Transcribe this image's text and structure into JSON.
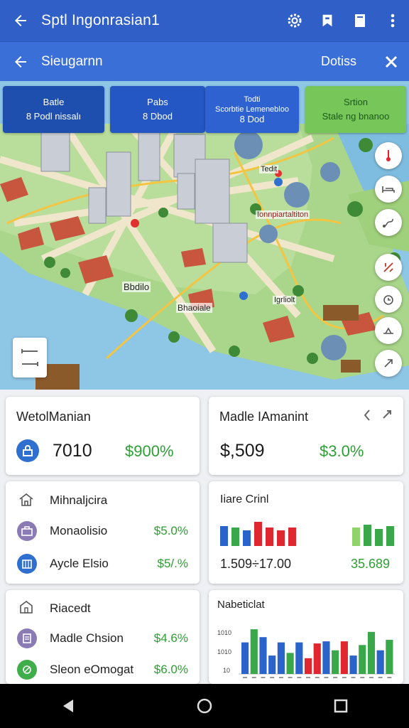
{
  "appbar": {
    "title": "Sptl Ingonrasian1",
    "back_icon": "arrow-left-icon",
    "actions": [
      "settings-gear-icon",
      "bookmark-icon",
      "document-icon",
      "more-vert-icon"
    ]
  },
  "subbar": {
    "title": "Sieugarnn",
    "option_label": "Dotiss",
    "close_icon": "close-icon"
  },
  "chips": [
    {
      "title": "Batle",
      "value": "8 Podl nissalı"
    },
    {
      "title": "Pabs",
      "value": "8 Dbod"
    },
    {
      "title": "Todti\nScorbtie Lemenebloo",
      "value": "8 Dod"
    },
    {
      "title": "Srtion",
      "value": "Stale ng bnanoo"
    }
  ],
  "map": {
    "labels": [
      "Bbdilo",
      "Ionnpiartaltiton",
      "Bhaoiale",
      "Tedit",
      "Igrliolt"
    ],
    "side_buttons": [
      "temperature-icon",
      "bed-icon",
      "route-icon",
      "dining-icon",
      "timer-icon",
      "fitness-icon",
      "pin-icon"
    ],
    "legend_icons": [
      "bus-icon",
      "tram-icon"
    ]
  },
  "cards": {
    "card1": {
      "title": "WetolManian",
      "icon": "lock-icon",
      "value": "7010",
      "percent": "$900%"
    },
    "card2": {
      "title": "Madle IAmanint",
      "value": "$,509",
      "percent": "$3.0%",
      "prev_icon": "chevron-left-icon",
      "next_icon": "chevron-right-icon"
    },
    "card3": {
      "title": "Mihnaljcira",
      "title_icon": "home-icon",
      "rows": [
        {
          "label": "Monaolisio",
          "value": "$5.0%",
          "icon": "briefcase-icon",
          "color": "#8a7bb5"
        },
        {
          "label": "Aycle Elsio",
          "value": "$5/.%",
          "icon": "building-icon",
          "color": "#2f6fd0"
        }
      ]
    },
    "card4": {
      "title": "Iiare Crinl",
      "value_left": "1.509÷17.00",
      "value_right": "35.689"
    },
    "card5": {
      "title": "Riacedt",
      "title_icon": "home-outline-icon",
      "rows": [
        {
          "label": "Madle Chsion",
          "value": "$4.6%",
          "icon": "doc-icon",
          "color": "#8a7bb5"
        },
        {
          "label": "Sleon eOmogat",
          "value": "$6.0%",
          "icon": "leaf-icon",
          "color": "#3fae4a"
        }
      ]
    },
    "card6": {
      "title": "Nabeticlat",
      "yticks": [
        "1010",
        "1010",
        "10"
      ]
    }
  },
  "chart_small": {
    "type": "bar",
    "groups": [
      {
        "colors": [
          "#2a63c9",
          "#3aa84a",
          "#2a63c9",
          "#e0262e",
          "#e0262e",
          "#e0262e",
          "#e0262e"
        ],
        "values": [
          28,
          26,
          22,
          34,
          26,
          22,
          26
        ]
      },
      {
        "colors": [
          "#8fd36a",
          "#3aa84a",
          "#3aa84a",
          "#3aa84a"
        ],
        "values": [
          26,
          30,
          24,
          28
        ]
      }
    ]
  },
  "chart_data": {
    "type": "bar",
    "title": "Nabeticlat",
    "categories": [
      "1",
      "2",
      "3",
      "4",
      "5",
      "6",
      "7",
      "8",
      "9",
      "10",
      "11",
      "12",
      "13",
      "14",
      "15",
      "16",
      "17"
    ],
    "values": [
      60,
      85,
      70,
      35,
      60,
      40,
      60,
      30,
      58,
      62,
      45,
      62,
      35,
      55,
      80,
      45,
      65
    ],
    "colors": [
      "#2a63c9",
      "#3aa84a",
      "#2a63c9",
      "#2a63c9",
      "#2a63c9",
      "#3aa84a",
      "#2a63c9",
      "#e0262e",
      "#e0262e",
      "#2a63c9",
      "#3aa84a",
      "#e0262e",
      "#2a63c9",
      "#3aa84a",
      "#3aa84a",
      "#2a63c9",
      "#3aa84a"
    ],
    "ylabels": [
      "1010",
      "1010",
      "10"
    ],
    "ylim": [
      0,
      100
    ]
  },
  "navbar": {
    "icons": [
      "back-triangle-icon",
      "home-circle-icon",
      "recents-square-icon"
    ]
  }
}
